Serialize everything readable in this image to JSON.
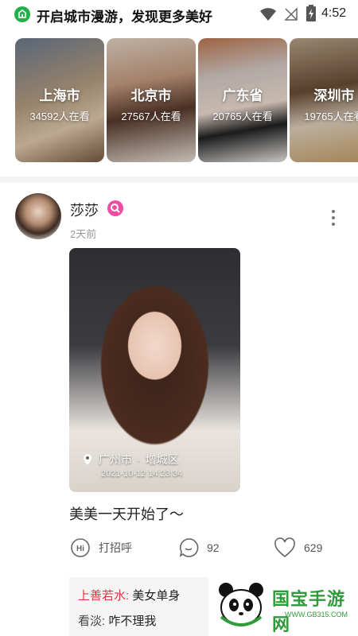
{
  "status_bar": {
    "title": "开启城市漫游，发现更多美好",
    "time": "4:52",
    "icons": [
      "app-icon",
      "wifi-icon",
      "no-signal-icon",
      "battery-charging-icon"
    ]
  },
  "cities": [
    {
      "name": "上海市",
      "viewers": "34592人在看"
    },
    {
      "name": "北京市",
      "viewers": "27567人在看"
    },
    {
      "name": "广东省",
      "viewers": "20765人在看"
    },
    {
      "name": "深圳市",
      "viewers": "19765人在看"
    }
  ],
  "post": {
    "username": "莎莎",
    "time_ago": "2天前",
    "location_city": "广州市",
    "location_district": "增城区",
    "photo_datetime": "2021-10-12  14:23:34",
    "caption": "美美一天开始了～",
    "actions": {
      "greet_label": "打招呼",
      "comment_count": "92",
      "like_count": "629"
    },
    "comments": [
      {
        "author": "上善若水:",
        "text": "美女单身"
      },
      {
        "author": "看淡:",
        "text": "咋不理我"
      }
    ]
  },
  "watermark": {
    "title": "国宝手游网",
    "url": "WWW.GB315.COM"
  },
  "colors": {
    "accent_green": "#22b04b",
    "badge_pink": "#f04da5",
    "comment_red": "#e0383e"
  }
}
